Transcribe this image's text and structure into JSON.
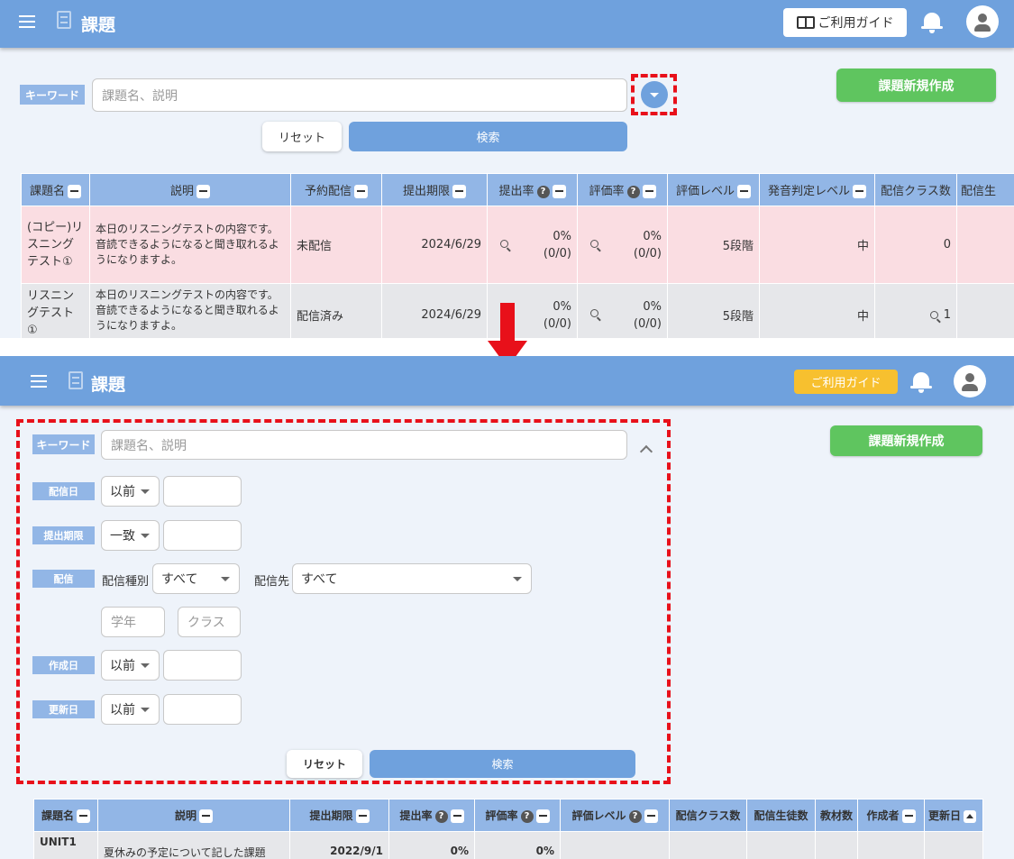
{
  "app": {
    "title": "課題",
    "guide_label": "ご利用ガイド"
  },
  "colors": {
    "header": "#6fa1dd",
    "label": "#92b6e6",
    "new_button": "#5fc55f",
    "guide_highlight": "#f7c02f",
    "annotation": "#e8101a"
  },
  "search": {
    "keyword_label": "キーワード",
    "keyword_placeholder": "課題名、説明",
    "reset": "リセット",
    "submit": "検索",
    "new_button": "課題新規作成"
  },
  "filters": {
    "delivery_date": {
      "label": "配信日",
      "op": "以前"
    },
    "deadline": {
      "label": "提出期限",
      "op": "一致"
    },
    "delivery": {
      "label": "配信",
      "type_label": "配信種別",
      "type_value": "すべて",
      "target_label": "配信先",
      "target_value": "すべて",
      "grade_placeholder": "学年",
      "class_placeholder": "クラス"
    },
    "created_date": {
      "label": "作成日",
      "op": "以前"
    },
    "updated_date": {
      "label": "更新日",
      "op": "以前"
    }
  },
  "table_top": {
    "headers": [
      "課題名",
      "説明",
      "予約配信",
      "提出期限",
      "提出率",
      "評価率",
      "評価レベル",
      "発音判定レベル",
      "配信クラス数",
      "配信生"
    ],
    "rows": [
      {
        "name": "(コピー)リスニングテスト①",
        "desc": "本日のリスニングテストの内容です。音読できるようになると聞き取れるようになりますよ。",
        "scheduled": "未配信",
        "deadline": "2024/6/29",
        "submit_rate": "0%",
        "submit_count": "(0/0)",
        "eval_rate": "0%",
        "eval_count": "(0/0)",
        "level": "5段階",
        "pron": "中",
        "classes": "0"
      },
      {
        "name": "リスニングテスト①",
        "desc": "本日のリスニングテストの内容です。音読できるようになると聞き取れるようになりますよ。",
        "scheduled": "配信済み",
        "deadline": "2024/6/29",
        "submit_rate": "0%",
        "submit_count": "(0/0)",
        "eval_rate": "0%",
        "eval_count": "(0/0)",
        "level": "5段階",
        "pron": "中",
        "classes": "1"
      }
    ]
  },
  "table_bottom": {
    "headers": [
      "課題名",
      "説明",
      "提出期限",
      "提出率",
      "評価率",
      "評価レベル",
      "配信クラス数",
      "配信生徒数",
      "教材数",
      "作成者",
      "更新日"
    ],
    "row": {
      "name": "UNIT1",
      "desc": "夏休みの予定について記した課題",
      "deadline": "2022/9/1",
      "submit_rate": "0%",
      "eval_rate": "0%"
    }
  }
}
